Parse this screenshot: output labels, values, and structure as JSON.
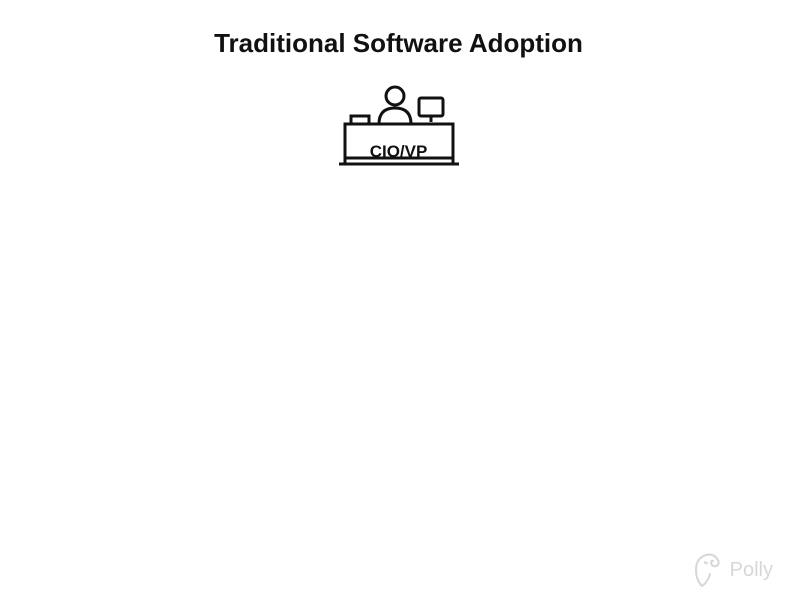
{
  "title": "Traditional Software Adoption",
  "figure": {
    "label": "CIO/VP"
  },
  "branding": {
    "name": "Polly"
  }
}
